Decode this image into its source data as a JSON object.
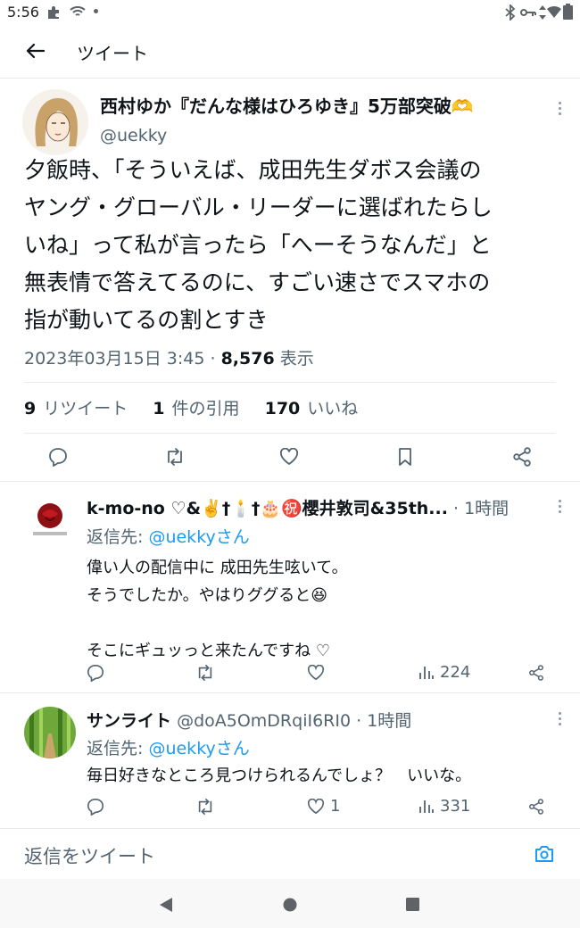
{
  "status_bar": {
    "time": "5:56"
  },
  "header": {
    "title": "ツイート"
  },
  "main_tweet": {
    "author_name": "西村ゆか『だんな様はひろゆき』5万部突破🫶",
    "handle": "@uekky",
    "text_lines": [
      "夕飯時、「そういえば、成田先生ダボス会議の",
      "ヤング・グローバル・リーダーに選ばれたらし",
      "いね」って私が言ったら「へーそうなんだ」と",
      "無表情で答えてるのに、すごい速さでスマホの",
      "指が動いてるの割とすき"
    ],
    "timestamp": "2023年03月15日 3:45",
    "separator": "·",
    "views_count": "8,576",
    "views_label": "表示",
    "retweets_count": "9",
    "retweets_label": "リツイート",
    "quotes_count": "1",
    "quotes_label": "件の引用",
    "likes_count": "170",
    "likes_label": "いいね"
  },
  "replies": [
    {
      "name": "k-mo-no ♡&✌️†🕯️†🎂㊗️櫻井敦司&35th...",
      "time": "· 1時間",
      "reply_to_label": "返信先: ",
      "reply_to_user": "@uekkyさん",
      "text_lines": [
        "偉い人の配信中に 成田先生呟いて。",
        "そうでしたか。やはりググると😆",
        "",
        "そこにギュッっと来たんですね ♡"
      ],
      "likes": "",
      "views": "224"
    },
    {
      "name": "サンライト",
      "handle": "@doA5OmDRqiI6RI0",
      "time": "· 1時間",
      "reply_to_label": "返信先: ",
      "reply_to_user": "@uekkyさん",
      "text_lines": [
        "毎日好きなところ見つけられるんでしょ？　いいな。"
      ],
      "likes": "1",
      "views": "331"
    }
  ],
  "composer": {
    "placeholder": "返信をツイート"
  },
  "colors": {
    "accent": "#1d9bf0",
    "text": "#0f1419",
    "secondary": "#536471",
    "divider": "#e6ecf0"
  }
}
